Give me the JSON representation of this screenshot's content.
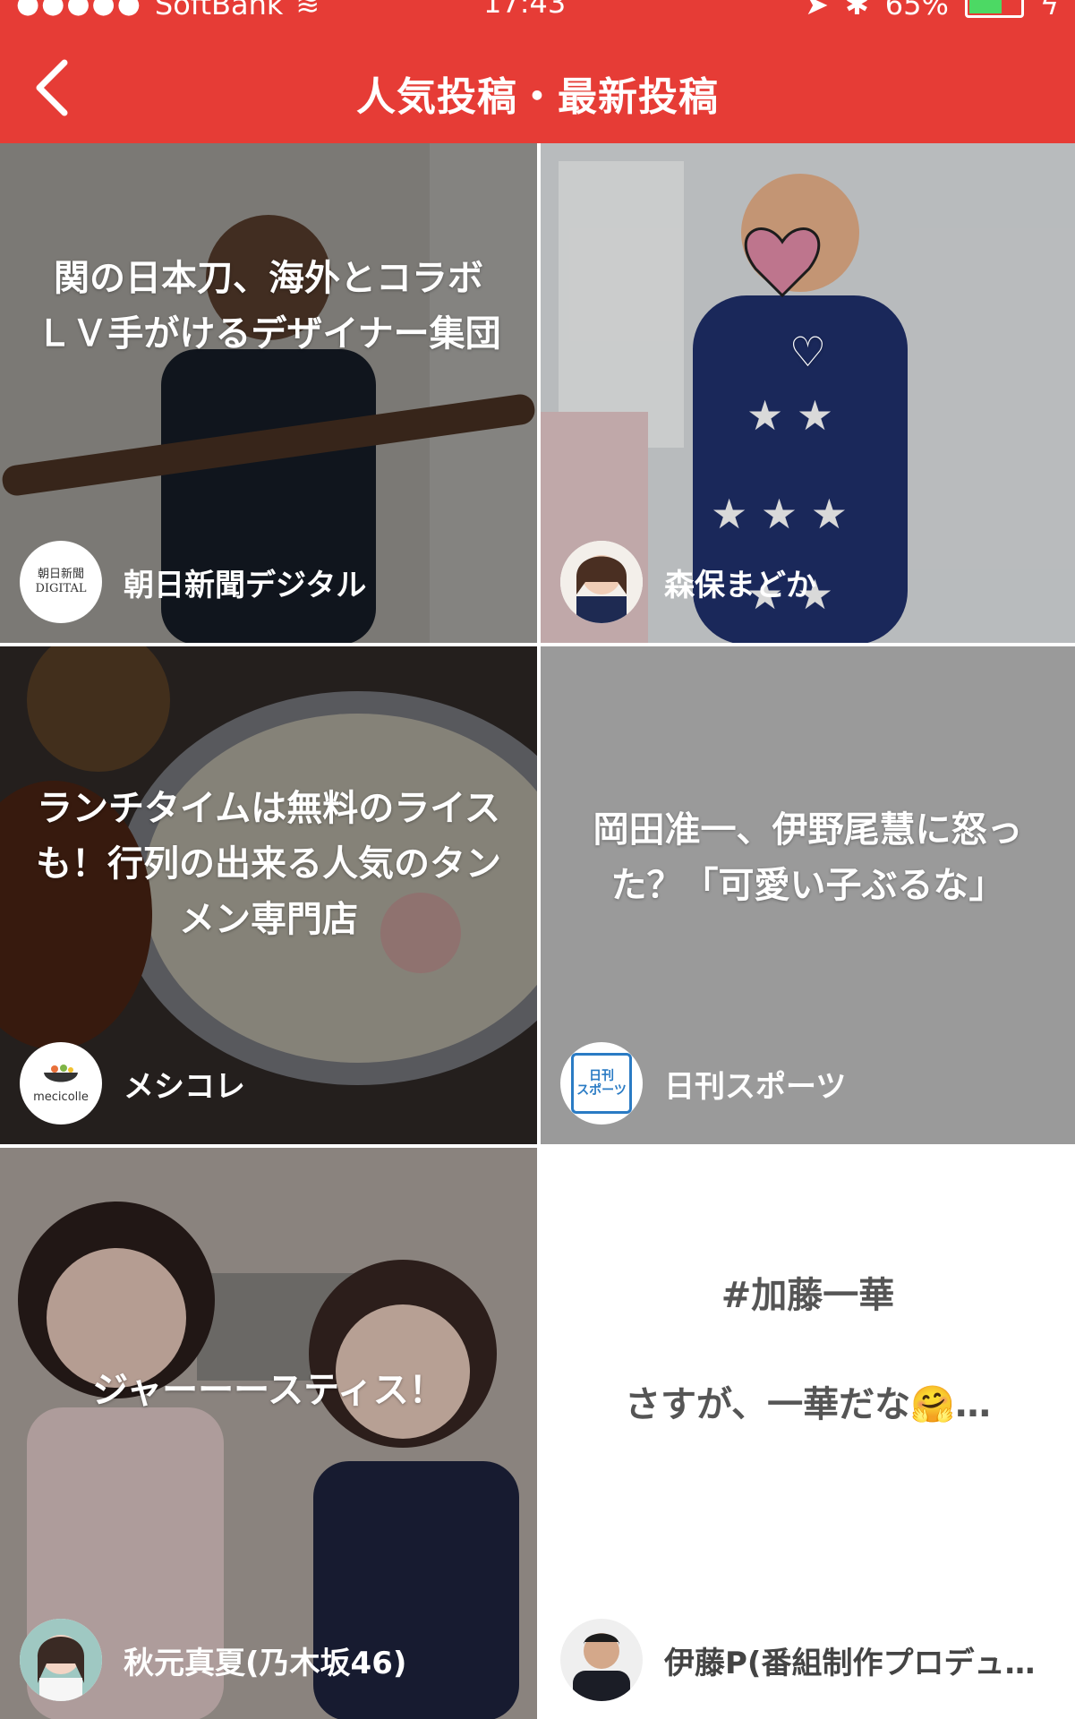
{
  "status": {
    "carrier": "SoftBank",
    "time": "17:43",
    "battery": "65%",
    "battery_level": 0.65
  },
  "header": {
    "title": "人気投稿・最新投稿",
    "back_icon": "chevron-left-icon"
  },
  "posts": [
    {
      "title": "関の日本刀、海外とコラボ　ＬＶ手がけるデザイナー集団",
      "author": "朝日新聞デジタル",
      "avatar_text": "朝日新聞\nDIGITAL"
    },
    {
      "title": "♡",
      "author": "森保まどか"
    },
    {
      "title": "ランチタイムは無料のライスも！行列の出来る人気のタンメン専門店",
      "author": "メシコレ",
      "avatar_text": "mecicolle"
    },
    {
      "title": "岡田准一、伊野尾慧に怒った？「可愛い子ぶるな」",
      "author": "日刊スポーツ",
      "avatar_text": "日刊\nスポーツ"
    },
    {
      "title": "ジャーーースティス！",
      "author": "秋元真夏(乃木坂46)"
    },
    {
      "title_line1": "#加藤一華",
      "title_line2": "さすが、一華だな🤗…",
      "author": "伊藤P(番組制作プロデュ…"
    }
  ],
  "colors": {
    "header_bg": "#e63c36",
    "gray_card": "#9a9a9a"
  }
}
